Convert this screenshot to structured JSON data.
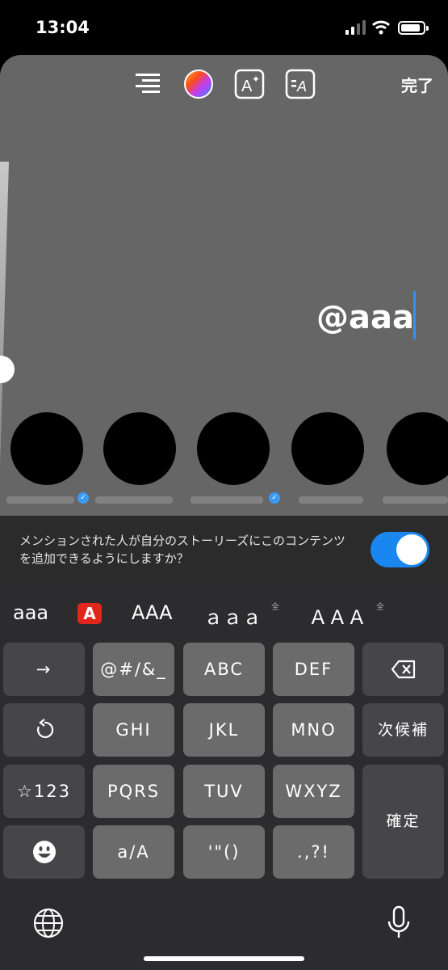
{
  "status": {
    "time": "13:04"
  },
  "toolbar": {
    "align_icon": "align-right-icon",
    "color_icon": "color-wheel-icon",
    "effect_icon": "text-effect-icon",
    "animate_icon": "text-animation-icon",
    "done_label": "完了"
  },
  "editor": {
    "text": "@aaa"
  },
  "mention_prompt": {
    "text": "メンションされた人が自分のストーリーズにこのコンテンツを追加できるようにしますか？",
    "enabled": true,
    "accent": "#1a86f0"
  },
  "candidates": {
    "c1": "aaa",
    "c2": "A",
    "c3": "AAA",
    "c4": "ａａａ",
    "c4_sup": "全",
    "c5": "ＡＡＡ",
    "c5_sup": "全"
  },
  "keys": {
    "arrow": "→",
    "sym": "@#/&_",
    "abc": "ABC",
    "def": "DEF",
    "backspace_icon": "delete-icon",
    "undo_icon": "undo-icon",
    "ghi": "GHI",
    "jkl": "JKL",
    "mno": "MNO",
    "next": "次候補",
    "num": "☆123",
    "pqrs": "PQRS",
    "tuv": "TUV",
    "wxyz": "WXYZ",
    "confirm": "確定",
    "emoji_icon": "emoji-icon",
    "case": "a/A",
    "quote": "'\"()",
    "punct": ".,?!"
  },
  "bottom": {
    "globe_icon": "globe-icon",
    "mic_icon": "microphone-icon"
  }
}
